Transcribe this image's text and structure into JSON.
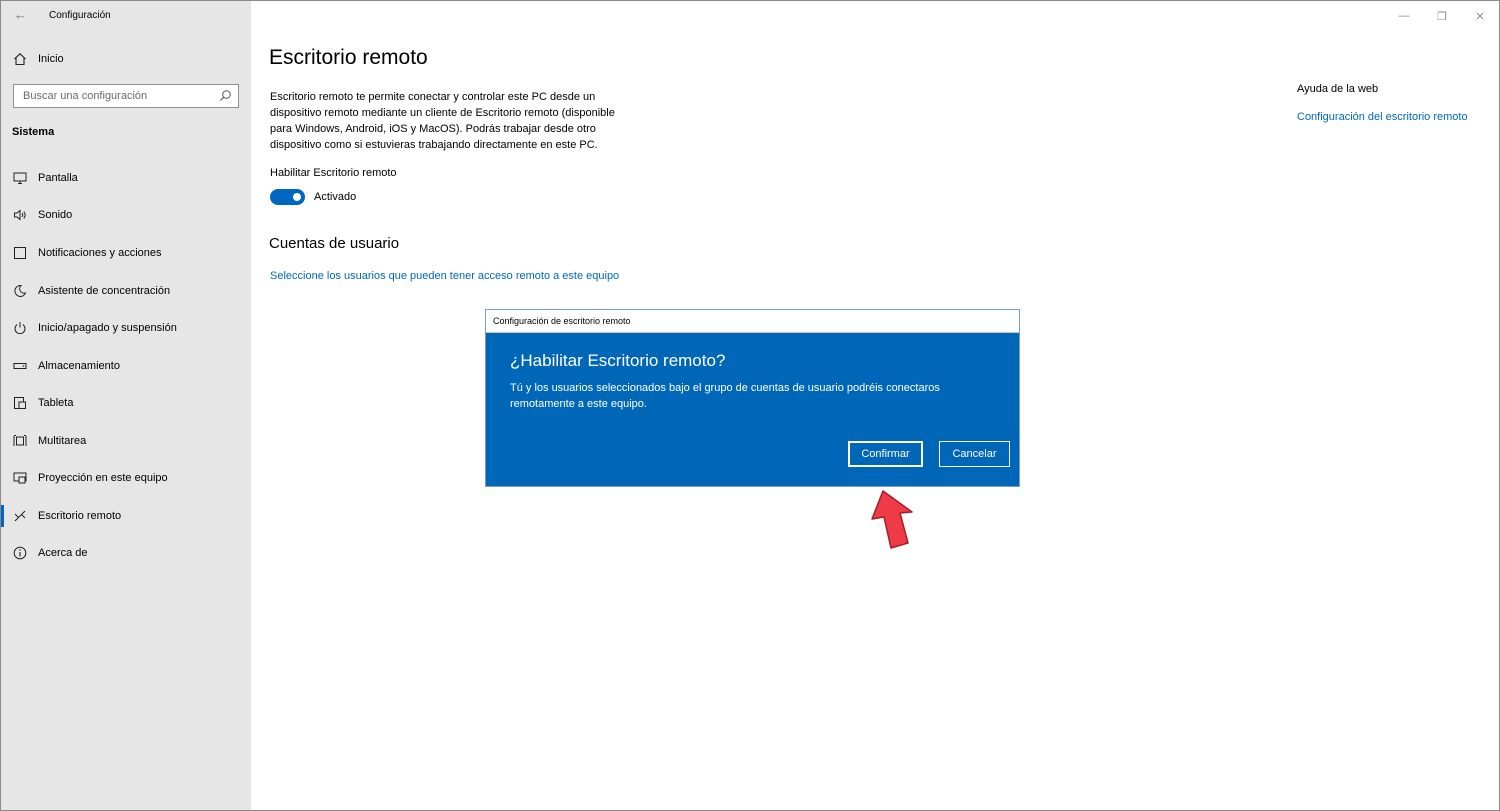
{
  "window": {
    "app_title": "Configuración",
    "back_glyph": "←",
    "controls": {
      "minimize": "—",
      "restore": "❐",
      "close": "✕"
    }
  },
  "sidebar": {
    "home_label": "Inicio",
    "search_placeholder": "Buscar una configuración",
    "section_title": "Sistema",
    "items": [
      {
        "label": "Pantalla",
        "icon": "monitor-icon"
      },
      {
        "label": "Sonido",
        "icon": "speaker-icon"
      },
      {
        "label": "Notificaciones y acciones",
        "icon": "notification-icon"
      },
      {
        "label": "Asistente de concentración",
        "icon": "moon-icon"
      },
      {
        "label": "Inicio/apagado y suspensión",
        "icon": "power-icon"
      },
      {
        "label": "Almacenamiento",
        "icon": "storage-icon"
      },
      {
        "label": "Tableta",
        "icon": "tablet-icon"
      },
      {
        "label": "Multitarea",
        "icon": "multitask-icon"
      },
      {
        "label": "Proyección en este equipo",
        "icon": "projection-icon"
      },
      {
        "label": "Escritorio remoto",
        "icon": "remote-desktop-icon",
        "selected": true
      },
      {
        "label": "Acerca de",
        "icon": "info-icon"
      }
    ]
  },
  "main": {
    "title": "Escritorio remoto",
    "description": "Escritorio remoto te permite conectar y controlar este PC desde un dispositivo remoto mediante un cliente de Escritorio remoto (disponible para Windows, Android, iOS y MacOS). Podrás trabajar desde otro dispositivo como si estuvieras trabajando directamente en este PC.",
    "toggle_label": "Habilitar Escritorio remoto",
    "toggle_state": "Activado",
    "toggle_on": true,
    "accounts_heading": "Cuentas de usuario",
    "accounts_link": "Seleccione los usuarios que pueden tener acceso remoto a este equipo"
  },
  "help": {
    "title": "Ayuda de la web",
    "link": "Configuración del escritorio remoto"
  },
  "dialog": {
    "title": "Configuración de escritorio remoto",
    "heading": "¿Habilitar Escritorio remoto?",
    "text": "Tú y los usuarios seleccionados bajo el grupo de cuentas de usuario podréis conectaros remotamente a este equipo.",
    "confirm_label": "Confirmar",
    "cancel_label": "Cancelar"
  },
  "colors": {
    "accent": "#0067b8",
    "sidebar_bg": "#e6e6e6",
    "dialog_bg": "#0067b8",
    "pointer_arrow": "#ef3a47"
  }
}
